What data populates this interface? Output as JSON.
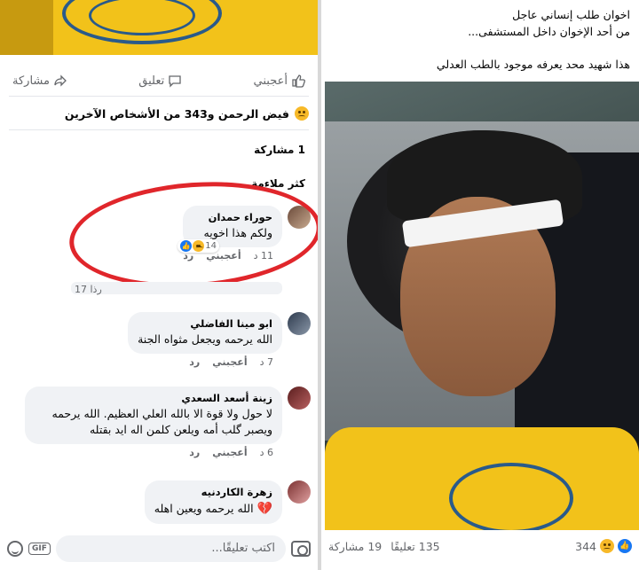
{
  "left": {
    "actions": {
      "like": "أعجبني",
      "comment": "تعليق",
      "share": "مشاركة"
    },
    "reactions_summary": "فيض الرحمن و343 من الأشخاص الآخرين",
    "shares_line": "1 مشاركة",
    "sort_label": "كثر ملاءمة",
    "comments": [
      {
        "name": "حوراء حمدان",
        "text": "ولكم هذا اخويه",
        "time": "11 د",
        "like": "أعجبني",
        "reply": "رد",
        "reactions": "14"
      },
      {
        "name": "ابو مينا الفاضلي",
        "text": "الله يرحمه ويجعل مثواه الجنة",
        "time": "7 د",
        "like": "أعجبني",
        "reply": "رد"
      },
      {
        "name": "زينة أسعد السعدي",
        "text": "لا حول ولا قوة الا بالله العلي العظيم. الله يرحمه ويصبر گلب أمه ويلعن كلمن اله ايد بقتله",
        "time": "6 د",
        "like": "أعجبني",
        "reply": "رد"
      },
      {
        "name": "زهرة الكاردنيه",
        "text": "الله يرحمه ويعين اهله",
        "reaction_icon": "broken-heart-icon"
      }
    ],
    "hidden_meta": "17 رذا",
    "input": {
      "placeholder": "اكتب تعليقًا...",
      "gif": "GIF"
    }
  },
  "right": {
    "post_lines": [
      "اخوان طلب إنساني عاجل",
      "من أحد الإخوان داخل المستشفى...",
      "هذا شهيد محد يعرفه موجود بالطب العدلي"
    ],
    "footer": {
      "reactions": "344",
      "shares": "19 مشاركة",
      "comments": "135 تعليقًا"
    }
  },
  "colors": {
    "highlight": "#e0262b",
    "facebook_blue": "#1877f2",
    "bubble": "#f0f2f5",
    "muted": "#65676b"
  }
}
